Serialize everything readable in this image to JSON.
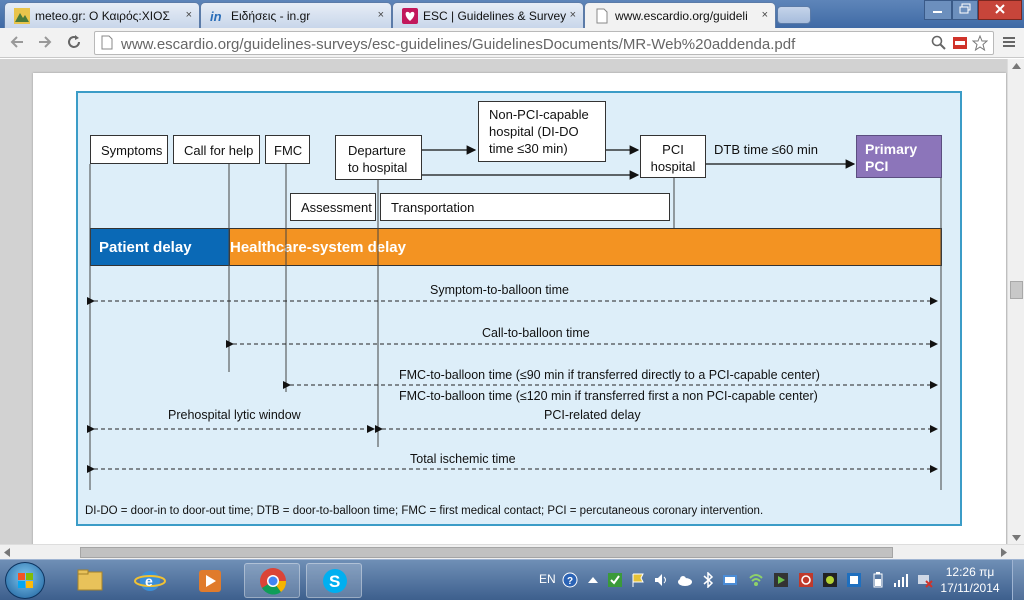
{
  "browser": {
    "tabs": [
      {
        "label": "meteo.gr: Ο Καιρός:ΧΙΟΣ",
        "icon": "meteo-favicon-icon"
      },
      {
        "label": "Ειδήσεις - in.gr",
        "icon": "in-gr-favicon-icon"
      },
      {
        "label": "ESC | Guidelines & Survey",
        "icon": "esc-favicon-icon"
      },
      {
        "label": "www.escardio.org/guideli",
        "icon": "page-favicon-icon"
      }
    ],
    "close_glyph": "×",
    "url": "www.escardio.org/guidelines-surveys/esc-guidelines/GuidelinesDocuments/MR-Web%20addenda.pdf"
  },
  "figure": {
    "boxes": {
      "symptoms": "Symptoms",
      "call_for_help": "Call for help",
      "fmc": "FMC",
      "departure_1": "Departure",
      "departure_2": "to hospital",
      "nonpci_1": "Non-PCI-capable",
      "nonpci_2": "hospital (DI-DO",
      "nonpci_3": "time ≤30 min)",
      "pci_hospital_1": "PCI",
      "pci_hospital_2": "hospital",
      "primary_pci_1": "Primary",
      "primary_pci_2": "PCI",
      "assessment": "Assessment",
      "transportation": "Transportation"
    },
    "dtb_label": "DTB time ≤60 min",
    "bars": {
      "patient_delay": "Patient delay",
      "healthcare_delay": "Healthcare-system delay"
    },
    "intervals": {
      "symptom_to_balloon": "Symptom-to-balloon time",
      "call_to_balloon": "Call-to-balloon time",
      "fmc_direct": "FMC-to-balloon time (≤90 min if transferred directly to a PCI-capable center)",
      "fmc_nonpci": "FMC-to-balloon time (≤120 min if transferred first a non PCI-capable center)",
      "prehospital_lytic": "Prehospital lytic window",
      "pci_related": "PCI-related delay",
      "total_ischemic": "Total ischemic time"
    },
    "footnote": "DI-DO = door-in to door-out time; DTB = door-to-balloon time; FMC = first medical contact; PCI = percutaneous coronary intervention.",
    "colors": {
      "patient_delay": "#0a69b6",
      "healthcare_delay": "#f39322",
      "primary_pci": "#8c75ba",
      "figure_bg": "#ddeef9"
    }
  },
  "taskbar": {
    "language": "EN",
    "time": "12:26 πμ",
    "date": "17/11/2014",
    "pinned": [
      "explorer-folder-icon",
      "internet-explorer-icon",
      "media-player-icon",
      "chrome-icon",
      "skype-icon"
    ]
  }
}
